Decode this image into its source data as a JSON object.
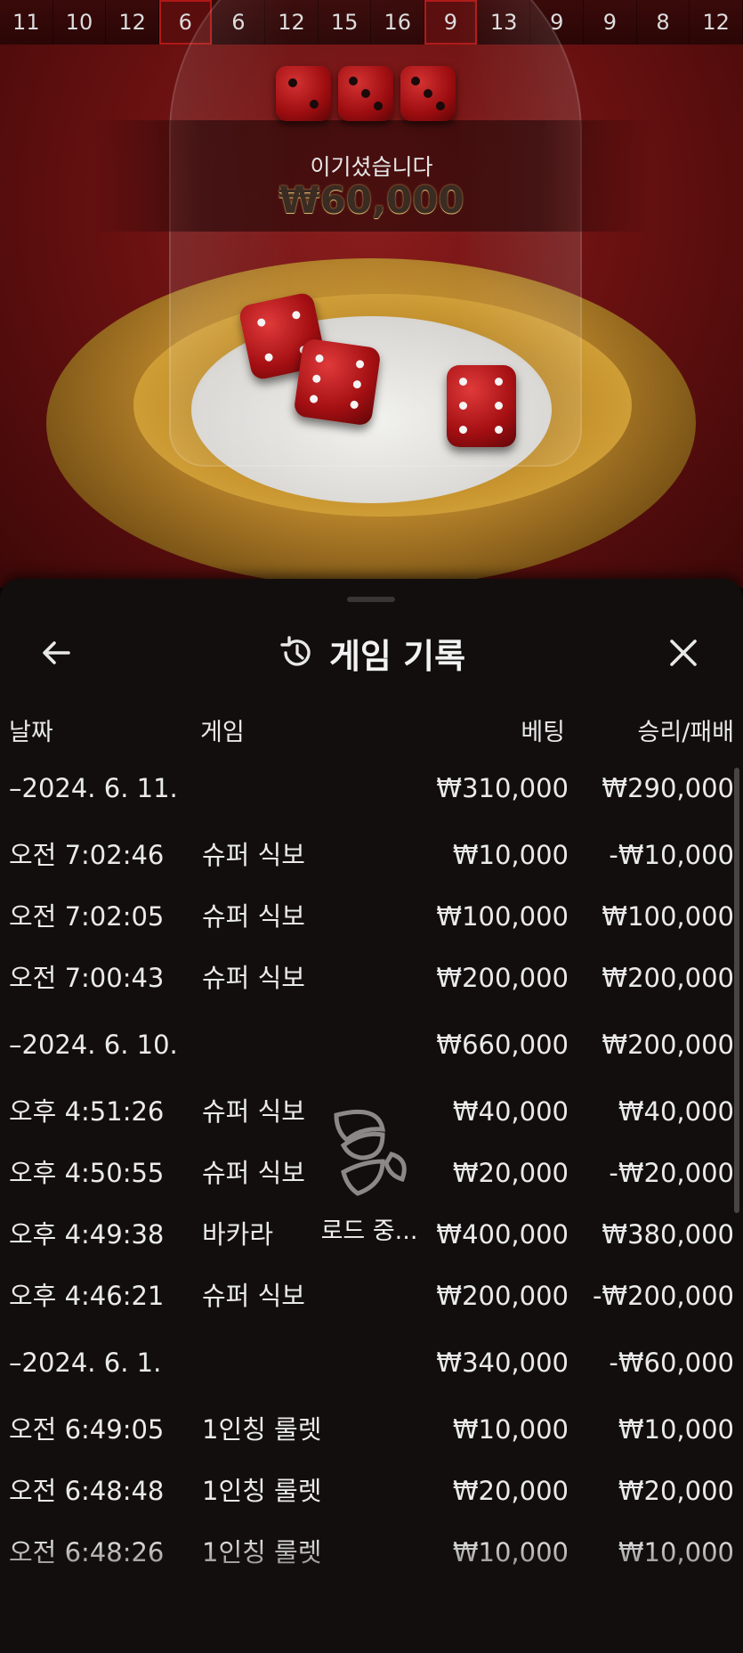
{
  "game": {
    "history_strip": [
      "11",
      "10",
      "12",
      "6",
      "6",
      "12",
      "15",
      "16",
      "9",
      "13",
      "9",
      "9",
      "8",
      "12"
    ],
    "result_dice": [
      2,
      3,
      3
    ],
    "win_label": "이기셨습니다",
    "win_amount": "₩60,000",
    "accent_red": "#9c0d10",
    "gold": "#c8952f"
  },
  "panel": {
    "title": "게임 기록",
    "title_icon": "history-icon",
    "back_icon": "arrow-left-icon",
    "close_icon": "close-icon",
    "columns": {
      "date": "날짜",
      "game": "게임",
      "bet": "베팅",
      "win_loss": "승리/패배"
    },
    "rows": [
      {
        "date": "–2024. 6. 11.",
        "game": "",
        "bet": "₩310,000",
        "win": "₩290,000",
        "group": true
      },
      {
        "date": "오전 7:02:46",
        "game": "슈퍼 식보",
        "bet": "₩10,000",
        "win": "-₩10,000",
        "group": false
      },
      {
        "date": "오전 7:02:05",
        "game": "슈퍼 식보",
        "bet": "₩100,000",
        "win": "₩100,000",
        "group": false
      },
      {
        "date": "오전 7:00:43",
        "game": "슈퍼 식보",
        "bet": "₩200,000",
        "win": "₩200,000",
        "group": false
      },
      {
        "date": "–2024. 6. 10.",
        "game": "",
        "bet": "₩660,000",
        "win": "₩200,000",
        "group": true
      },
      {
        "date": "오후 4:51:26",
        "game": "슈퍼 식보",
        "bet": "₩40,000",
        "win": "₩40,000",
        "group": false
      },
      {
        "date": "오후 4:50:55",
        "game": "슈퍼 식보",
        "bet": "₩20,000",
        "win": "-₩20,000",
        "group": false
      },
      {
        "date": "오후 4:49:38",
        "game": "바카라",
        "bet": "₩400,000",
        "win": "₩380,000",
        "group": false
      },
      {
        "date": "오후 4:46:21",
        "game": "슈퍼 식보",
        "bet": "₩200,000",
        "win": "-₩200,000",
        "group": false
      },
      {
        "date": "–2024. 6. 1.",
        "game": "",
        "bet": "₩340,000",
        "win": "-₩60,000",
        "group": true
      },
      {
        "date": "오전 6:49:05",
        "game": "1인칭 룰렛",
        "bet": "₩10,000",
        "win": "₩10,000",
        "group": false
      },
      {
        "date": "오전 6:48:48",
        "game": "1인칭 룰렛",
        "bet": "₩20,000",
        "win": "₩20,000",
        "group": false
      },
      {
        "date": "오전 6:48:26",
        "game": "1인칭 룰렛",
        "bet": "₩10,000",
        "win": "₩10,000",
        "group": false
      }
    ],
    "loading_text": "로드 중..."
  }
}
